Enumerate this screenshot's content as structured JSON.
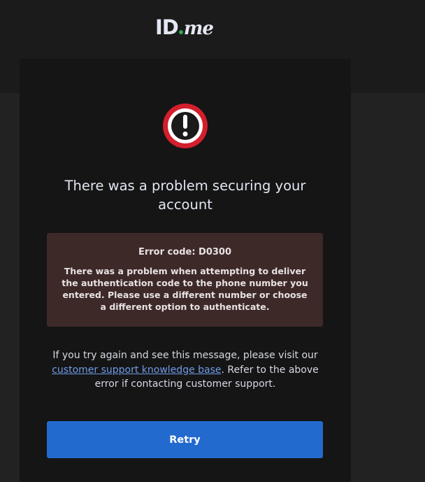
{
  "logo": {
    "id_text": "ID",
    "me_text": "me"
  },
  "icons": {
    "alert": "exclamation-circle-icon"
  },
  "colors": {
    "alert_red": "#d31f2c",
    "error_box_bg": "#3e2929",
    "link": "#6f9be8",
    "button": "#236acf",
    "logo_dot": "#2fa84f"
  },
  "card": {
    "title": "There was a problem securing your account",
    "error": {
      "code": "Error code: D0300",
      "message": "There was a problem when attempting to deliver the authentication code to the phone number you entered. Please use a different number or choose a different option to authenticate."
    },
    "help": {
      "before_link": "If you try again and see this message, please visit our ",
      "link_text": "customer support knowledge base",
      "after_link": ". Refer to the above error if contacting customer support."
    },
    "retry_label": "Retry"
  }
}
